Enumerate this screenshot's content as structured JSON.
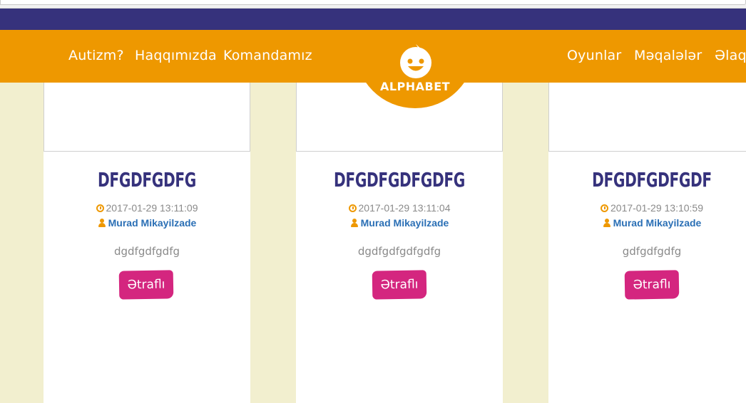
{
  "nav": {
    "left": [
      "Autizm?",
      "Haqqımızda",
      "Komandamız"
    ],
    "right": [
      "Oyunlar",
      "Məqalələr",
      "Əlaqə"
    ]
  },
  "logo": {
    "text": "ALPHABET"
  },
  "posts": [
    {
      "title": "DFGDFGDFG",
      "date": "2017-01-29 13:11:09",
      "author": "Murad Mikayilzade",
      "excerpt": "dgdfgdfgdfg",
      "button": "Ətraflı"
    },
    {
      "title": "DFGDFGDFGDFG",
      "date": "2017-01-29 13:11:04",
      "author": "Murad Mikayilzade",
      "excerpt": "dgdfgdfgdfgdfg",
      "button": "Ətraflı"
    },
    {
      "title": "DFGDFGDFGDF",
      "date": "2017-01-29 13:10:59",
      "author": "Murad Mikayilzade",
      "excerpt": "gdfgdfgdfg",
      "button": "Ətraflı"
    }
  ],
  "colors": {
    "topbar": "#36327c",
    "navbar": "#ee9800",
    "page_bg": "#f2efcf",
    "title": "#36327c",
    "author": "#2a6fb5",
    "button": "#d4267f"
  },
  "icons": {
    "date": "clock-icon",
    "author": "user-icon",
    "logo": "smiley-face-icon"
  }
}
